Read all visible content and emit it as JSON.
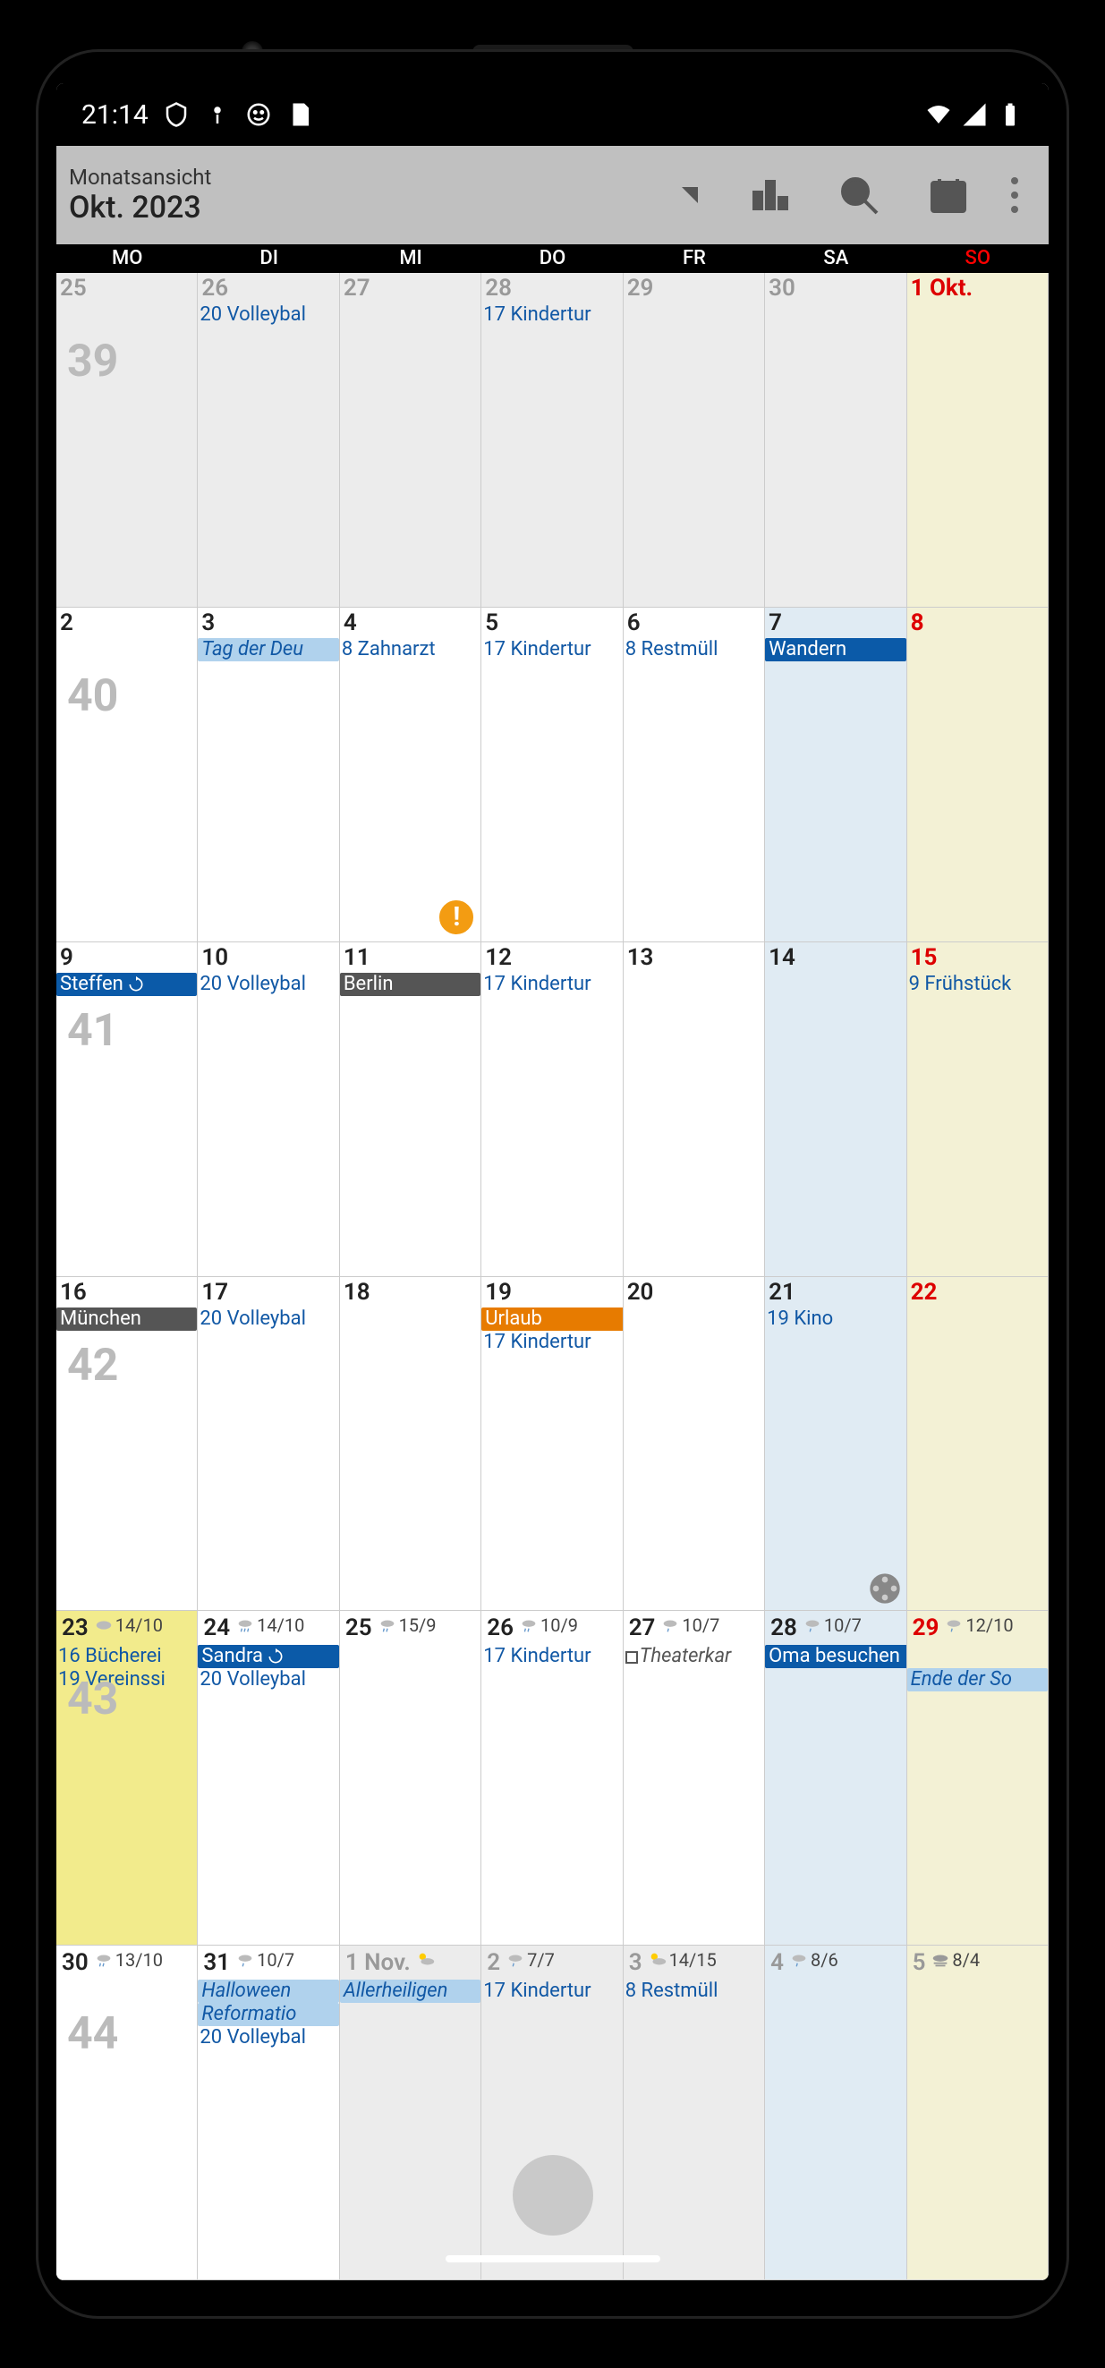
{
  "status": {
    "time": "21:14"
  },
  "toolbar": {
    "view_label": "Monatsansicht",
    "month_label": "Okt. 2023"
  },
  "dow": [
    "MO",
    "DI",
    "MI",
    "DO",
    "FR",
    "SA",
    "SO"
  ],
  "weeks": [
    "39",
    "40",
    "41",
    "42",
    "43",
    "44"
  ],
  "cells": {
    "r0c0": {
      "num": "25"
    },
    "r0c1": {
      "num": "26",
      "ev1": "20 Volleybal"
    },
    "r0c2": {
      "num": "27"
    },
    "r0c3": {
      "num": "28",
      "ev1": "17 Kindertur"
    },
    "r0c4": {
      "num": "29"
    },
    "r0c5": {
      "num": "30"
    },
    "r0c6": {
      "num": "1 Okt."
    },
    "r1c0": {
      "num": "2"
    },
    "r1c1": {
      "num": "3",
      "chip": "Tag der Deu"
    },
    "r1c2": {
      "num": "4",
      "ev1": "8 Zahnarzt"
    },
    "r1c3": {
      "num": "5",
      "ev1": "17 Kindertur"
    },
    "r1c4": {
      "num": "6",
      "ev1": "8 Restmüll"
    },
    "r1c5": {
      "num": "7",
      "chip": "Wandern"
    },
    "r1c6": {
      "num": "8"
    },
    "r2c0": {
      "num": "9",
      "chip": "Steffen"
    },
    "r2c1": {
      "num": "10",
      "ev1": "20 Volleybal"
    },
    "r2c2": {
      "num": "11",
      "chip": "Berlin"
    },
    "r2c3": {
      "num": "12",
      "ev1": "17 Kindertur"
    },
    "r2c4": {
      "num": "13"
    },
    "r2c5": {
      "num": "14"
    },
    "r2c6": {
      "num": "15",
      "ev1": "9 Frühstück"
    },
    "r3c0": {
      "num": "16",
      "chip": "München"
    },
    "r3c1": {
      "num": "17",
      "ev1": "20 Volleybal"
    },
    "r3c2": {
      "num": "18"
    },
    "r3c3": {
      "num": "19",
      "chip": "Urlaub",
      "ev1": "17 Kindertur"
    },
    "r3c4": {
      "num": "20"
    },
    "r3c5": {
      "num": "21",
      "ev1": "19 Kino"
    },
    "r3c6": {
      "num": "22"
    },
    "r4c0": {
      "num": "23",
      "w": "14/10",
      "ev1": "16 Bücherei",
      "ev2": "19 Vereinssi"
    },
    "r4c1": {
      "num": "24",
      "w": "14/10",
      "chip": "Sandra",
      "ev1": "20 Volleybal"
    },
    "r4c2": {
      "num": "25",
      "w": "15/9"
    },
    "r4c3": {
      "num": "26",
      "w": "10/9",
      "ev1": "17 Kindertur"
    },
    "r4c4": {
      "num": "27",
      "w": "10/7",
      "ev1": "Theaterkar"
    },
    "r4c5": {
      "num": "28",
      "w": "10/7",
      "chip": "Oma besuchen"
    },
    "r4c6": {
      "num": "29",
      "w": "12/10",
      "chip": "Ende der So"
    },
    "r5c0": {
      "num": "30",
      "w": "13/10"
    },
    "r5c1": {
      "num": "31",
      "w": "10/7",
      "chip": "Halloween",
      "chip2": "Reformatio",
      "ev1": "20 Volleybal"
    },
    "r5c2": {
      "num": "1 Nov.",
      "chip": "Allerheiligen"
    },
    "r5c3": {
      "num": "2",
      "w": "7/7",
      "ev1": "17 Kindertur"
    },
    "r5c4": {
      "num": "3",
      "w": "14/15",
      "ev1": "8 Restmüll"
    },
    "r5c5": {
      "num": "4",
      "w": "8/6"
    },
    "r5c6": {
      "num": "5",
      "w": "8/4"
    }
  }
}
